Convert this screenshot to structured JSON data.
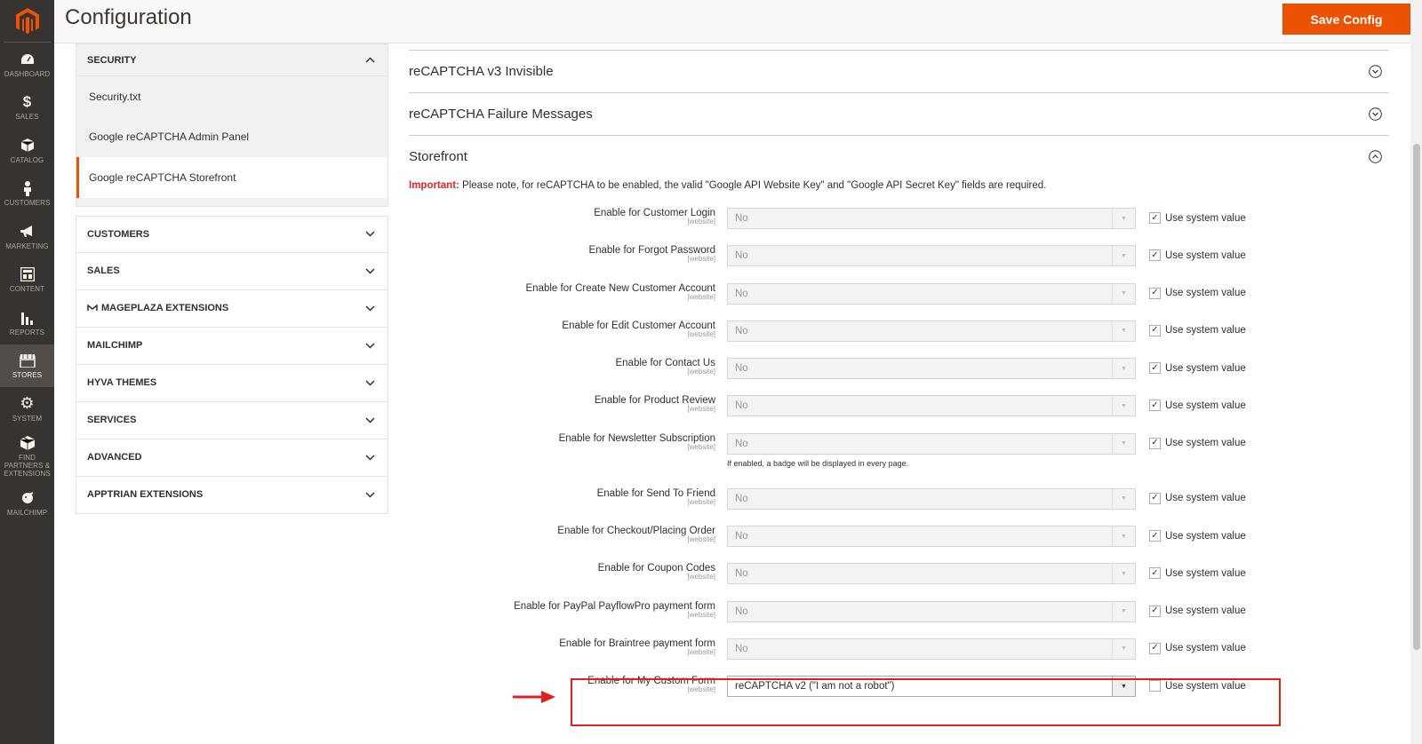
{
  "header": {
    "title": "Configuration",
    "save_label": "Save Config"
  },
  "nav": {
    "items": [
      {
        "label": "DASHBOARD",
        "icon": "dashboard-icon"
      },
      {
        "label": "SALES",
        "icon": "dollar-icon"
      },
      {
        "label": "CATALOG",
        "icon": "box-icon"
      },
      {
        "label": "CUSTOMERS",
        "icon": "person-icon"
      },
      {
        "label": "MARKETING",
        "icon": "megaphone-icon"
      },
      {
        "label": "CONTENT",
        "icon": "layout-icon"
      },
      {
        "label": "REPORTS",
        "icon": "bar-chart-icon"
      },
      {
        "label": "STORES",
        "icon": "store-icon"
      },
      {
        "label": "SYSTEM",
        "icon": "gear-icon"
      },
      {
        "label": "FIND PARTNERS & EXTENSIONS",
        "icon": "package-icon"
      },
      {
        "label": "MAILCHIMP",
        "icon": "mailchimp-icon"
      }
    ]
  },
  "sidebar": {
    "security": {
      "title": "SECURITY",
      "items": [
        "Security.txt",
        "Google reCAPTCHA Admin Panel",
        "Google reCAPTCHA Storefront"
      ]
    },
    "sections": [
      "CUSTOMERS",
      "SALES",
      "MAGEPLAZA EXTENSIONS",
      "MAILCHIMP",
      "HYVA THEMES",
      "SERVICES",
      "ADVANCED",
      "APPTRIAN EXTENSIONS"
    ]
  },
  "groups": {
    "v3": "reCAPTCHA v3 Invisible",
    "failure": "reCAPTCHA Failure Messages",
    "storefront": "Storefront"
  },
  "note": {
    "strong": "Important:",
    "text": " Please note, for reCAPTCHA to be enabled, the valid \"Google API Website Key\" and \"Google API Secret Key\" fields are required."
  },
  "scope": "[website]",
  "use_system": "Use system value",
  "fields": [
    {
      "label": "Enable for Customer Login",
      "value": "No"
    },
    {
      "label": "Enable for Forgot Password",
      "value": "No"
    },
    {
      "label": "Enable for Create New Customer Account",
      "value": "No"
    },
    {
      "label": "Enable for Edit Customer Account",
      "value": "No"
    },
    {
      "label": "Enable for Contact Us",
      "value": "No"
    },
    {
      "label": "Enable for Product Review",
      "value": "No"
    },
    {
      "label": "Enable for Newsletter Subscription",
      "value": "No",
      "hint": "If enabled, a badge will be displayed in every page."
    },
    {
      "label": "Enable for Send To Friend",
      "value": "No"
    },
    {
      "label": "Enable for Checkout/Placing Order",
      "value": "No"
    },
    {
      "label": "Enable for Coupon Codes",
      "value": "No"
    },
    {
      "label": "Enable for PayPal PayflowPro payment form",
      "value": "No"
    },
    {
      "label": "Enable for Braintree payment form",
      "value": "No"
    },
    {
      "label": "Enable for My Custom Form",
      "value": "reCAPTCHA v2 (\"I am not a robot\")"
    }
  ]
}
